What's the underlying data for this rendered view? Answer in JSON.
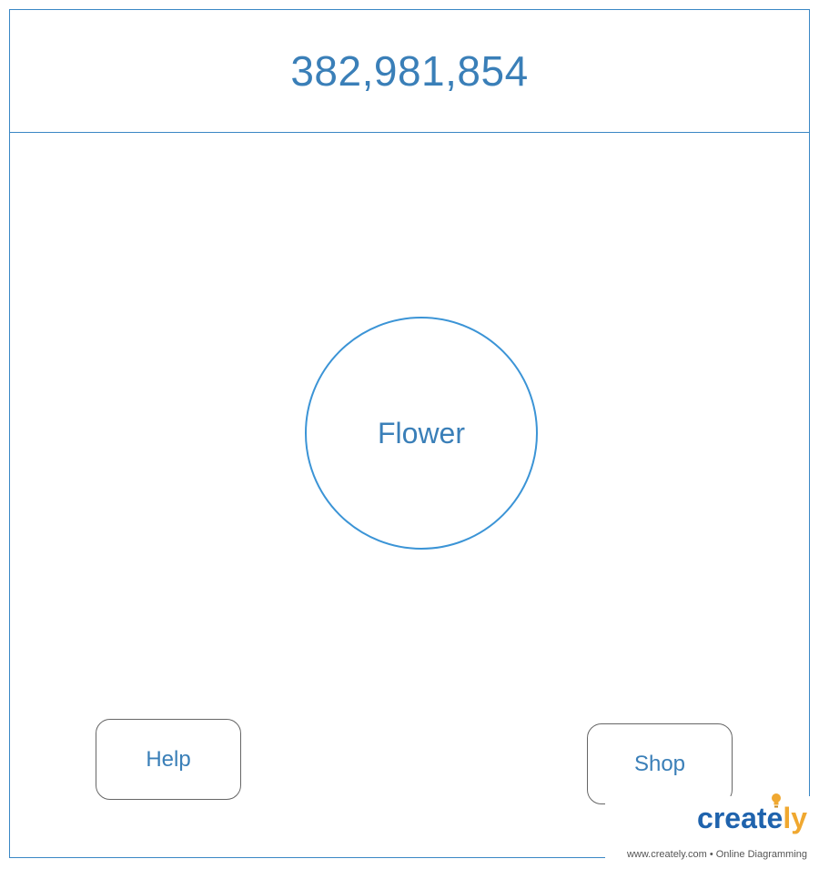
{
  "header": {
    "counter": "382,981,854"
  },
  "center": {
    "label": "Flower"
  },
  "buttons": {
    "help_label": "Help",
    "shop_label": "Shop"
  },
  "watermark": {
    "brand_main": "creat",
    "brand_accent": "ly",
    "brand_middle": "e",
    "tagline": "www.creately.com • Online Diagramming",
    "icon": "lightbulb-icon"
  },
  "colors": {
    "border": "#3a87c5",
    "text": "#3a7fb8",
    "button_border": "#666666",
    "brand_blue": "#1f63ad",
    "brand_orange": "#f0a830"
  }
}
